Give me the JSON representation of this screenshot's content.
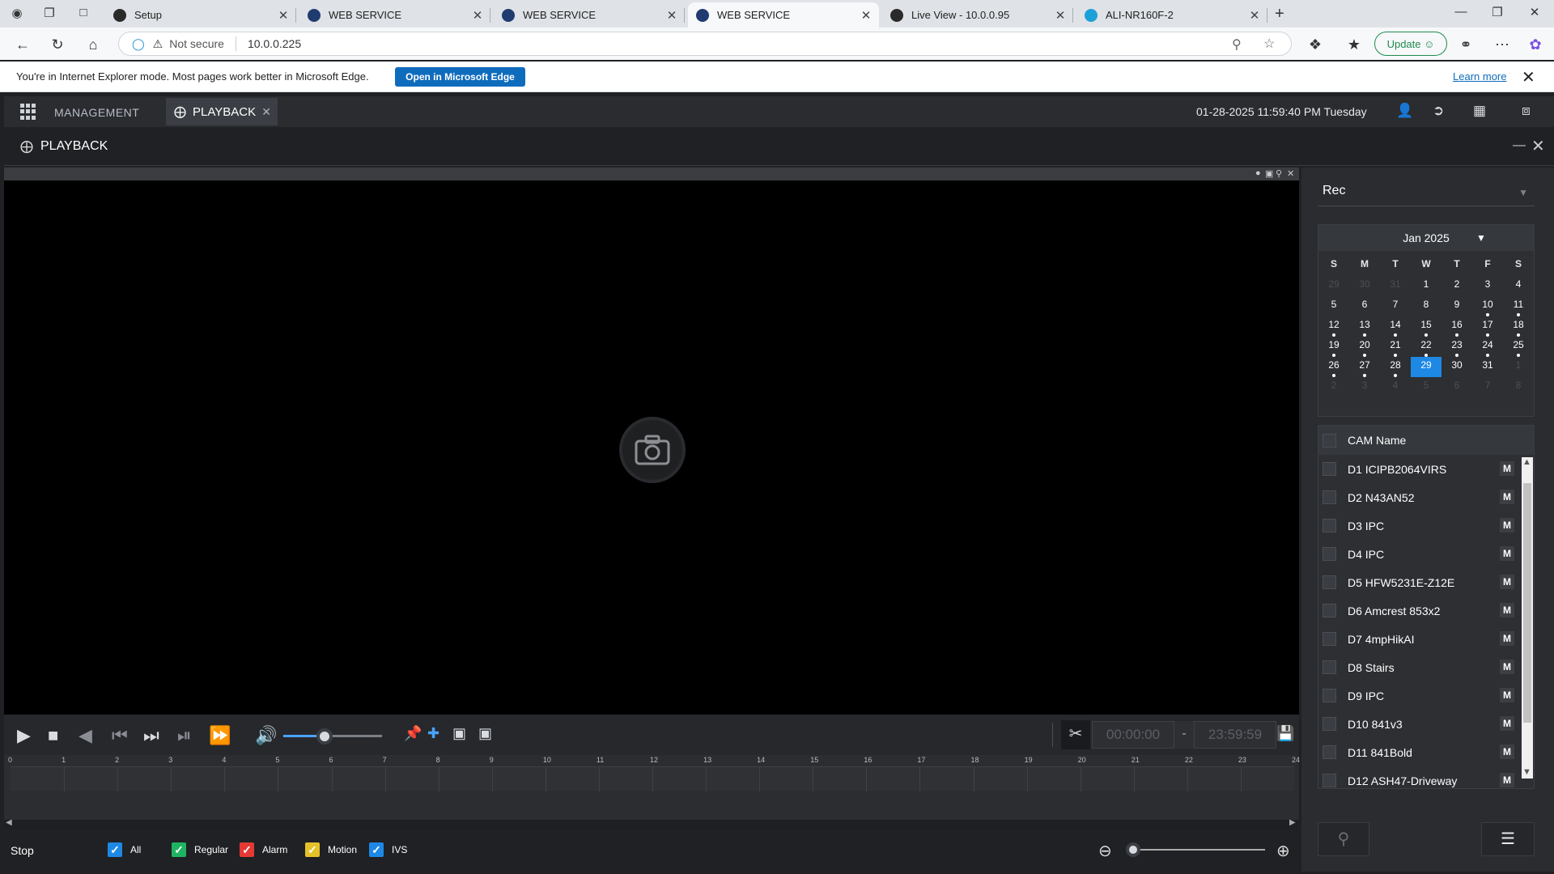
{
  "browser": {
    "tabs": [
      {
        "title": "Setup",
        "color": "#2a2a2a"
      },
      {
        "title": "WEB SERVICE",
        "color": "#1f3b70"
      },
      {
        "title": "WEB SERVICE",
        "color": "#1f3b70"
      },
      {
        "title": "WEB SERVICE",
        "color": "#1f3b70",
        "active": true
      },
      {
        "title": "Live View - 10.0.0.95",
        "color": "#2a2a2a"
      },
      {
        "title": "ALI-NR160F-2",
        "color": "#1ba0d8"
      }
    ],
    "security_label": "Not secure",
    "url": "10.0.0.225",
    "update_label": "Update"
  },
  "ie_bar": {
    "message": "You're in Internet Explorer mode. Most pages work better in Microsoft Edge.",
    "open_button": "Open in Microsoft Edge",
    "learn_more": "Learn more"
  },
  "app": {
    "management": "MANAGEMENT",
    "playback_tab": "PLAYBACK",
    "datetime": "01-28-2025 11:59:40 PM Tuesday",
    "panel_title": "PLAYBACK"
  },
  "controls": {
    "volume_fraction": 0.42,
    "start_time": "00:00:00",
    "end_time": "23:59:59",
    "separator": "-"
  },
  "timeline": {
    "ticks": [
      "0",
      "1",
      "2",
      "3",
      "4",
      "5",
      "6",
      "7",
      "8",
      "9",
      "10",
      "11",
      "12",
      "13",
      "14",
      "15",
      "16",
      "17",
      "18",
      "19",
      "20",
      "21",
      "22",
      "23",
      "24"
    ]
  },
  "status": {
    "state": "Stop",
    "legend": [
      {
        "label": "All",
        "color": "#1e88e5"
      },
      {
        "label": "Regular",
        "color": "#1fb462"
      },
      {
        "label": "Alarm",
        "color": "#e53935"
      },
      {
        "label": "Motion",
        "color": "#e6c229"
      },
      {
        "label": "IVS",
        "color": "#1e88e5"
      }
    ]
  },
  "right_panel": {
    "record_type": "Rec",
    "calendar": {
      "month": "Jan 2025",
      "weekdays": [
        "S",
        "M",
        "T",
        "W",
        "T",
        "F",
        "S"
      ],
      "weeks": [
        [
          {
            "d": "29",
            "dim": true
          },
          {
            "d": "30",
            "dim": true
          },
          {
            "d": "31",
            "dim": true
          },
          {
            "d": "1"
          },
          {
            "d": "2"
          },
          {
            "d": "3"
          },
          {
            "d": "4"
          }
        ],
        [
          {
            "d": "5"
          },
          {
            "d": "6"
          },
          {
            "d": "7"
          },
          {
            "d": "8"
          },
          {
            "d": "9"
          },
          {
            "d": "10",
            "dot": true
          },
          {
            "d": "11",
            "dot": true
          }
        ],
        [
          {
            "d": "12",
            "dot": true
          },
          {
            "d": "13",
            "dot": true
          },
          {
            "d": "14",
            "dot": true
          },
          {
            "d": "15",
            "dot": true
          },
          {
            "d": "16",
            "dot": true
          },
          {
            "d": "17",
            "dot": true
          },
          {
            "d": "18",
            "dot": true
          }
        ],
        [
          {
            "d": "19",
            "dot": true
          },
          {
            "d": "20",
            "dot": true
          },
          {
            "d": "21",
            "dot": true
          },
          {
            "d": "22",
            "dot": true
          },
          {
            "d": "23",
            "dot": true
          },
          {
            "d": "24",
            "dot": true
          },
          {
            "d": "25",
            "dot": true
          }
        ],
        [
          {
            "d": "26",
            "dot": true
          },
          {
            "d": "27",
            "dot": true
          },
          {
            "d": "28",
            "dot": true
          },
          {
            "d": "29",
            "sel": true
          },
          {
            "d": "30"
          },
          {
            "d": "31"
          },
          {
            "d": "1",
            "dim": true
          }
        ],
        [
          {
            "d": "2",
            "dim": true
          },
          {
            "d": "3",
            "dim": true
          },
          {
            "d": "4",
            "dim": true
          },
          {
            "d": "5",
            "dim": true
          },
          {
            "d": "6",
            "dim": true
          },
          {
            "d": "7",
            "dim": true
          },
          {
            "d": "8",
            "dim": true
          }
        ]
      ]
    },
    "cam_header": "CAM Name",
    "mark_label": "M",
    "cameras": [
      "D1 ICIPB2064VIRS",
      "D2 N43AN52",
      "D3 IPC",
      "D4 IPC",
      "D5 HFW5231E-Z12E",
      "D6 Amcrest 853x2",
      "D7 4mpHikAI",
      "D8 Stairs",
      "D9 IPC",
      "D10 841v3",
      "D11 841Bold",
      "D12 ASH47-Driveway"
    ]
  }
}
